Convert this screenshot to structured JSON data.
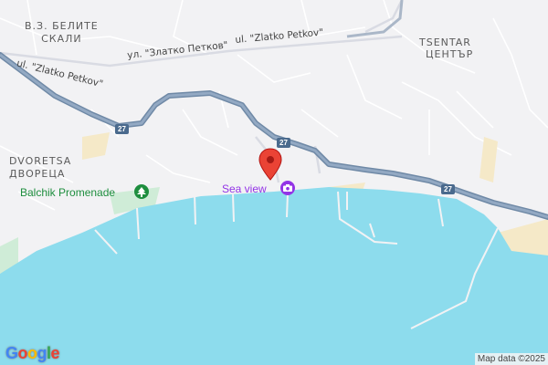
{
  "labels": {
    "belite_skali": "В.З. БЕЛИТЕ\nСКАЛИ",
    "tsentar_latin": "TSENTAR",
    "tsentar_cyr": "ЦЕНТЪР",
    "dvoretsa_latin": "DVORETSA",
    "dvoretsa_cyr": "ДВОРЕЦА"
  },
  "roads": {
    "zlatko_latin_left": "ul. \"Zlatko Petkov\"",
    "zlatko_cyr": "ул. \"Златко Петков\"",
    "zlatko_latin_right": "ul. \"Zlatko Petkov\"",
    "route_number": "27"
  },
  "pois": {
    "promenade": {
      "label": "Balchik Promenade",
      "color": "#1e8e3e",
      "icon": "tree-icon"
    },
    "sea_view": {
      "label": "Sea view",
      "color": "#9334e6",
      "icon": "camera-icon"
    }
  },
  "marker": {
    "color": "#ea4335",
    "icon": "map-pin-icon"
  },
  "branding": {
    "logo": "Google",
    "attribution": "Map data ©2025"
  },
  "colors": {
    "water": "#8ddced",
    "land": "#f2f2f4",
    "park": "#cfecd7",
    "highway": "#7e93ad"
  }
}
